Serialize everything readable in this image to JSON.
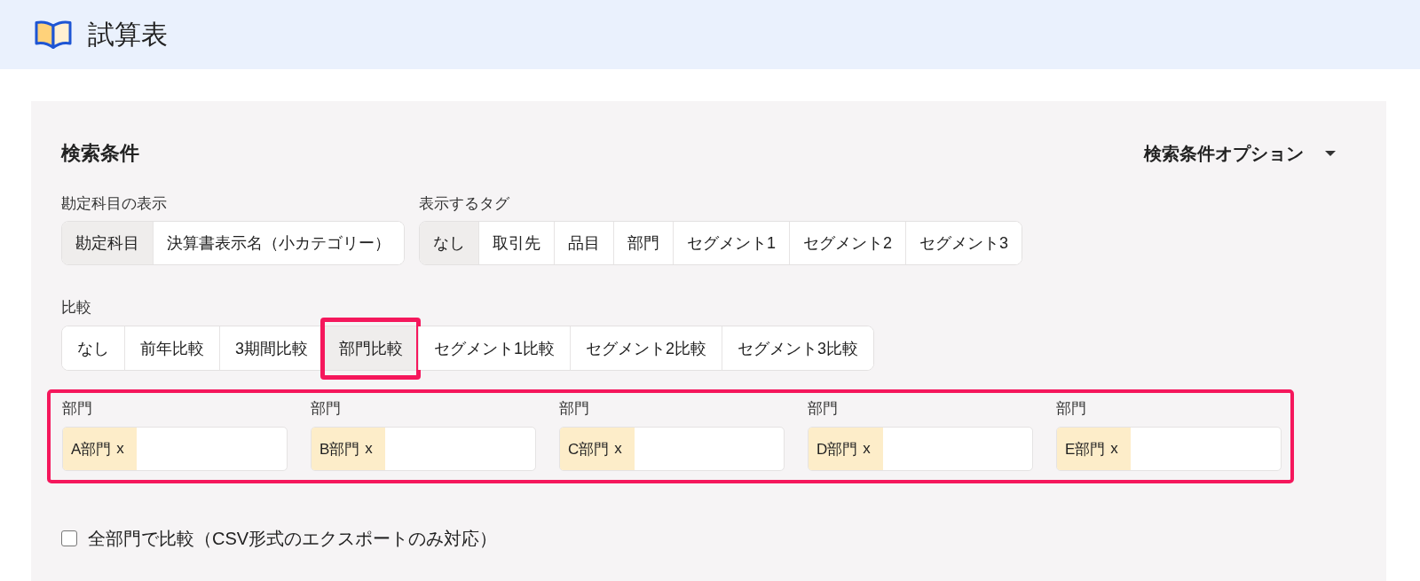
{
  "header": {
    "title": "試算表"
  },
  "search": {
    "title": "検索条件",
    "options_button": "検索条件オプション"
  },
  "account_display": {
    "label": "勘定科目の表示",
    "options": [
      {
        "label": "勘定科目",
        "selected": true
      },
      {
        "label": "決算書表示名（小カテゴリー）",
        "selected": false
      }
    ]
  },
  "tags": {
    "label": "表示するタグ",
    "options": [
      {
        "label": "なし",
        "selected": true
      },
      {
        "label": "取引先",
        "selected": false
      },
      {
        "label": "品目",
        "selected": false
      },
      {
        "label": "部門",
        "selected": false
      },
      {
        "label": "セグメント1",
        "selected": false
      },
      {
        "label": "セグメント2",
        "selected": false
      },
      {
        "label": "セグメント3",
        "selected": false
      }
    ]
  },
  "comparison": {
    "label": "比較",
    "options": [
      {
        "label": "なし",
        "selected": false,
        "highlighted": false
      },
      {
        "label": "前年比較",
        "selected": false,
        "highlighted": false
      },
      {
        "label": "3期間比較",
        "selected": false,
        "highlighted": false
      },
      {
        "label": "部門比較",
        "selected": true,
        "highlighted": true
      },
      {
        "label": "セグメント1比較",
        "selected": false,
        "highlighted": false
      },
      {
        "label": "セグメント2比較",
        "selected": false,
        "highlighted": false
      },
      {
        "label": "セグメント3比較",
        "selected": false,
        "highlighted": false
      }
    ]
  },
  "departments": {
    "highlighted": true,
    "fields": [
      {
        "label": "部門",
        "tags": [
          {
            "label": "A部門",
            "remove": "x"
          }
        ]
      },
      {
        "label": "部門",
        "tags": [
          {
            "label": "B部門",
            "remove": "x"
          }
        ]
      },
      {
        "label": "部門",
        "tags": [
          {
            "label": "C部門",
            "remove": "x"
          }
        ]
      },
      {
        "label": "部門",
        "tags": [
          {
            "label": "D部門",
            "remove": "x"
          }
        ]
      },
      {
        "label": "部門",
        "tags": [
          {
            "label": "E部門",
            "remove": "x"
          }
        ]
      }
    ]
  },
  "compare_all": {
    "label": "全部門で比較（CSV形式のエクスポートのみ対応）",
    "checked": false
  }
}
